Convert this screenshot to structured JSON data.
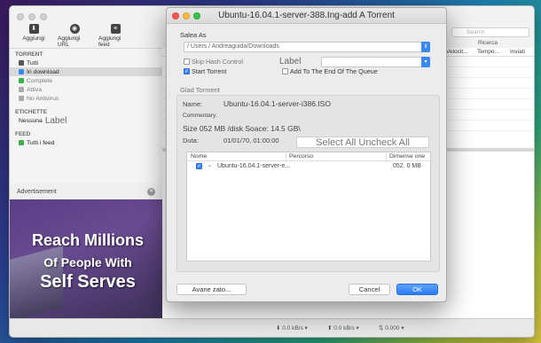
{
  "app": {
    "toolbar": [
      {
        "label": "Aggiungi",
        "icon": "add-torrent-icon"
      },
      {
        "label": "Aggiungi URL",
        "icon": "add-url-icon"
      },
      {
        "label": "Aggiungi feed",
        "icon": "add-feed-icon"
      }
    ],
    "sidebar": {
      "torrent_header": "TORRENT",
      "items": [
        {
          "label": "Tutti",
          "icon": "all-icon"
        },
        {
          "label": "In download",
          "icon": "download-icon"
        },
        {
          "label": "Complete",
          "icon": "complete-icon"
        },
        {
          "label": "Attiva",
          "icon": "active-icon"
        },
        {
          "label": "No Antivirus",
          "icon": "inactive-icon"
        }
      ],
      "labels_header": "ETICHETTE",
      "label_none": "Nessuna",
      "label_word": "Label",
      "feed_header": "FEED",
      "feed_item": "Tutti i feed"
    },
    "search": {
      "placeholder": "Search",
      "label": "Ricerca"
    },
    "columns": [
      "Velocit...",
      "Tempo...",
      "Inviati"
    ],
    "advert": {
      "header": "Advertisement",
      "line1": "Reach Millions",
      "line2": "Of People With",
      "line3": "Self Serves"
    },
    "status": {
      "down": "⬇ 0.0 kB/s ▾",
      "up": "⬆ 0.0 kB/s ▾",
      "ratio": "⇅ 0.000 ▾"
    }
  },
  "dialog": {
    "title": "Ubuntu-16.04.1-server-388.Ing-add A Torrent",
    "save_as_label": "Salea As",
    "path": "/ Users / Andreaguida/Downloads",
    "skip_hash": "Skip Hash Control",
    "label_field_label": "Label",
    "start_torrent": "Start Torrent",
    "add_to_end": "Add To The End Of The Queue",
    "section_title": "Glad Torment",
    "name_label": "Name:",
    "name_value": "Ubuntu-16.04.1-server-i386.ISO",
    "comment_label": "Commentary:",
    "size_line": "Size 052 MB /disk Soace: 14.5 GB\\",
    "date_label": "Duta:",
    "date_value": "01/01/70, 01:00:00",
    "select_buttons": "Select All Uncheck All",
    "file_columns": {
      "name": "Nome",
      "path": "Percorso",
      "size": "Dimense one"
    },
    "files": [
      {
        "name": "Ubuntu-16.04.1-server-e...",
        "size": "052. 0 MB"
      }
    ],
    "advanced_button": "Avane zato...",
    "cancel_button": "Cancel",
    "ok_button": "OK"
  }
}
